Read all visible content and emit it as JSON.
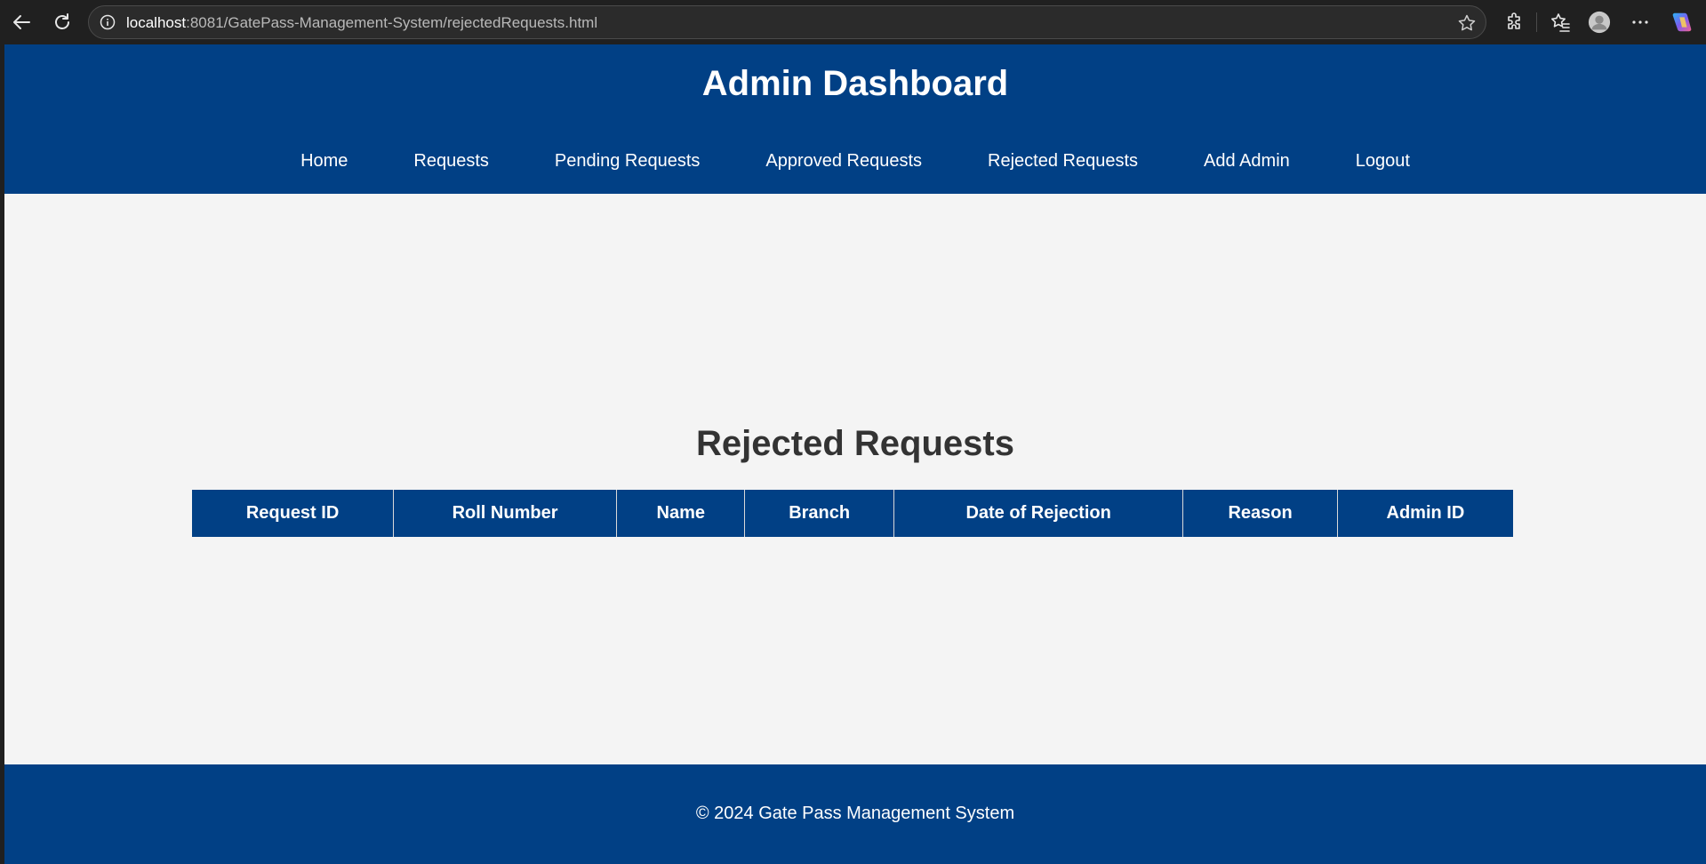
{
  "browser": {
    "url_host": "localhost",
    "url_rest": ":8081/GatePass-Management-System/rejectedRequests.html"
  },
  "header": {
    "title": "Admin Dashboard"
  },
  "nav": {
    "items": [
      {
        "label": "Home"
      },
      {
        "label": "Requests"
      },
      {
        "label": "Pending Requests"
      },
      {
        "label": "Approved Requests"
      },
      {
        "label": "Rejected Requests"
      },
      {
        "label": "Add Admin"
      },
      {
        "label": "Logout"
      }
    ]
  },
  "main": {
    "title": "Rejected Requests",
    "table": {
      "columns": [
        "Request ID",
        "Roll Number",
        "Name",
        "Branch",
        "Date of Rejection",
        "Reason",
        "Admin ID"
      ],
      "rows": []
    }
  },
  "footer": {
    "text": "© 2024 Gate Pass Management System"
  },
  "colors": {
    "brand": "#014085",
    "background": "#f4f4f4",
    "heading_text": "#333333"
  },
  "icons": {
    "back": "back-arrow-icon",
    "reload": "reload-icon",
    "info": "info-icon",
    "favorite": "star-icon",
    "extensions": "puzzle-icon",
    "favorites": "favorites-icon",
    "profile": "profile-icon",
    "menu": "more-icon",
    "copilot": "copilot-icon"
  }
}
